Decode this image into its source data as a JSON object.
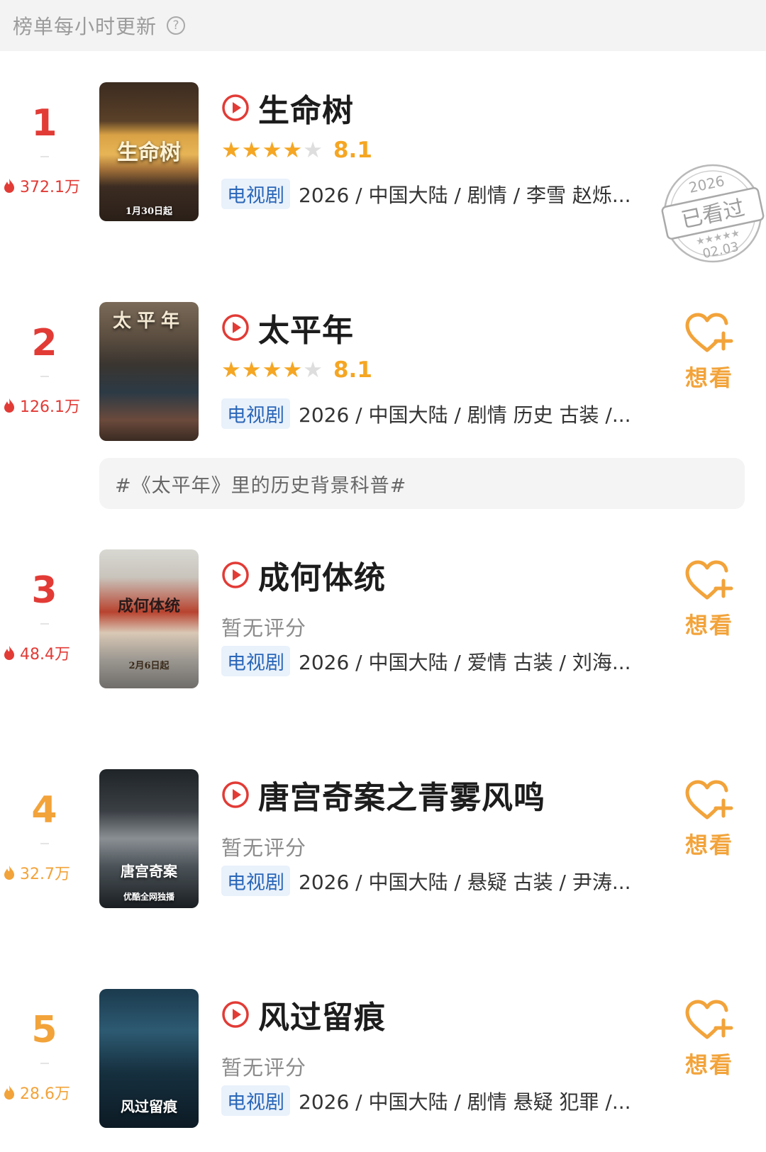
{
  "header": {
    "title": "榜单每小时更新",
    "help_glyph": "?"
  },
  "items": [
    {
      "rank": "1",
      "heat": "372.1万",
      "name": "生命树",
      "rating": {
        "stars": 4,
        "max": 5,
        "score": "8.1"
      },
      "no_rating_text": "",
      "tag": "电视剧",
      "meta": "2026 / 中国大陆 / 剧情 / 李雪 赵烁...",
      "poster": {
        "title": "生命树",
        "date": "1月30日起"
      },
      "status": "watched",
      "stamp": {
        "year": "2026",
        "label": "已看过",
        "date": "02.03"
      }
    },
    {
      "rank": "2",
      "heat": "126.1万",
      "name": "太平年",
      "rating": {
        "stars": 4,
        "max": 5,
        "score": "8.1"
      },
      "no_rating_text": "",
      "tag": "电视剧",
      "meta": "2026 / 中国大陆 / 剧情 历史 古装 /...",
      "poster": {
        "title": "太平年"
      },
      "status": "want",
      "want_label": "想看"
    },
    {
      "rank": "3",
      "heat": "48.4万",
      "name": "成何体统",
      "no_rating_text": "暂无评分",
      "tag": "电视剧",
      "meta": "2026 / 中国大陆 / 爱情 古装 / 刘海...",
      "poster": {
        "title": "成何体统",
        "date": "2月6日起"
      },
      "status": "want",
      "want_label": "想看"
    },
    {
      "rank": "4",
      "heat": "32.7万",
      "name": "唐宫奇案之青雾风鸣",
      "no_rating_text": "暂无评分",
      "tag": "电视剧",
      "meta": "2026 / 中国大陆 / 悬疑 古装 / 尹涛...",
      "poster": {
        "title": "唐宫奇案",
        "sub": "优酷全网独播"
      },
      "status": "want",
      "want_label": "想看"
    },
    {
      "rank": "5",
      "heat": "28.6万",
      "name": "风过留痕",
      "no_rating_text": "暂无评分",
      "tag": "电视剧",
      "meta": "2026 / 中国大陆 / 剧情 悬疑 犯罪 /...",
      "poster": {
        "title": "风过留痕"
      },
      "status": "want",
      "want_label": "想看"
    }
  ],
  "topic": "#《太平年》里的历史背景科普#",
  "colors": {
    "rank_red": "#e23b36",
    "rank_orange": "#f2a33a",
    "star": "#f5a623",
    "tag_bg": "#e9f1fb",
    "tag_text": "#2b67b8"
  }
}
